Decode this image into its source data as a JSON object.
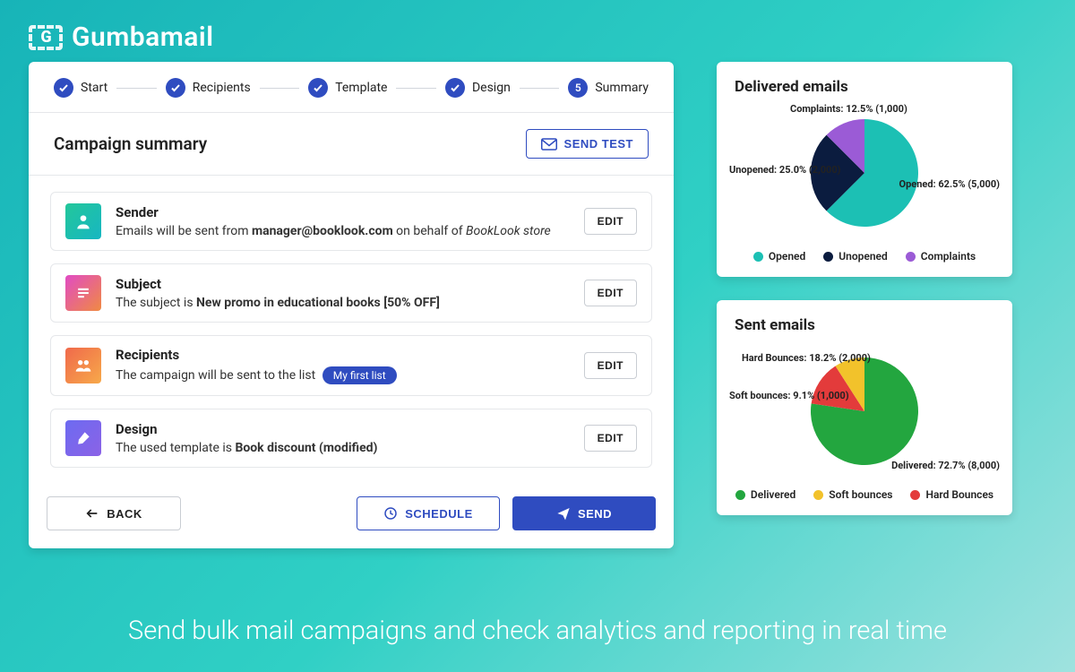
{
  "app_name": "Gumbamail",
  "tagline": "Send bulk mail campaigns and check analytics and reporting in real time",
  "stepper": [
    {
      "label": "Start",
      "state": "done"
    },
    {
      "label": "Recipients",
      "state": "done"
    },
    {
      "label": "Template",
      "state": "done"
    },
    {
      "label": "Design",
      "state": "done"
    },
    {
      "label": "Summary",
      "state": "current",
      "number": "5"
    }
  ],
  "summary": {
    "title": "Campaign summary",
    "send_test_label": "SEND TEST",
    "cards": {
      "sender": {
        "title": "Sender",
        "prefix": "Emails will be sent from ",
        "email": "manager@booklook.com",
        "mid": " on behalf of ",
        "behalf": "BookLook store",
        "edit": "EDIT"
      },
      "subject": {
        "title": "Subject",
        "prefix": "The subject is ",
        "value": "New promo in educational books [50% OFF]",
        "edit": "EDIT"
      },
      "recipients": {
        "title": "Recipients",
        "prefix": "The campaign will be sent to the list",
        "chip": "My first list",
        "edit": "EDIT"
      },
      "design": {
        "title": "Design",
        "prefix": "The used template is ",
        "value": "Book discount (modified)",
        "edit": "EDIT"
      }
    },
    "buttons": {
      "back": "BACK",
      "schedule": "SCHEDULE",
      "send": "SEND"
    }
  },
  "chart_delivered": {
    "title": "Delivered emails",
    "labels": {
      "opened": "Opened: 62.5% (5,000)",
      "unopened": "Unopened: 25.0% (2,000)",
      "complaints": "Complaints: 12.5% (1,000)"
    },
    "legend": [
      {
        "name": "Opened",
        "color": "#1cc0b4"
      },
      {
        "name": "Unopened",
        "color": "#0b1c3f"
      },
      {
        "name": "Complaints",
        "color": "#9b5bd6"
      }
    ]
  },
  "chart_sent": {
    "title": "Sent emails",
    "labels": {
      "delivered": "Delivered: 72.7% (8,000)",
      "hard_bounces": "Hard Bounces: 18.2% (2,000)",
      "soft_bounces": "Soft bounces: 9.1% (1,000)"
    },
    "legend": [
      {
        "name": "Delivered",
        "color": "#23a63f"
      },
      {
        "name": "Soft bounces",
        "color": "#f2c22b"
      },
      {
        "name": "Hard Bounces",
        "color": "#e33b3b"
      }
    ]
  },
  "chart_data": [
    {
      "type": "pie",
      "title": "Delivered emails",
      "series": [
        {
          "name": "Opened",
          "value": 5000,
          "percent": 62.5,
          "color": "#1cc0b4"
        },
        {
          "name": "Unopened",
          "value": 2000,
          "percent": 25.0,
          "color": "#0b1c3f"
        },
        {
          "name": "Complaints",
          "value": 1000,
          "percent": 12.5,
          "color": "#9b5bd6"
        }
      ]
    },
    {
      "type": "pie",
      "title": "Sent emails",
      "series": [
        {
          "name": "Delivered",
          "value": 8000,
          "percent": 72.7,
          "color": "#23a63f"
        },
        {
          "name": "Hard Bounces",
          "value": 2000,
          "percent": 18.2,
          "color": "#e33b3b"
        },
        {
          "name": "Soft bounces",
          "value": 1000,
          "percent": 9.1,
          "color": "#f2c22b"
        }
      ]
    }
  ]
}
